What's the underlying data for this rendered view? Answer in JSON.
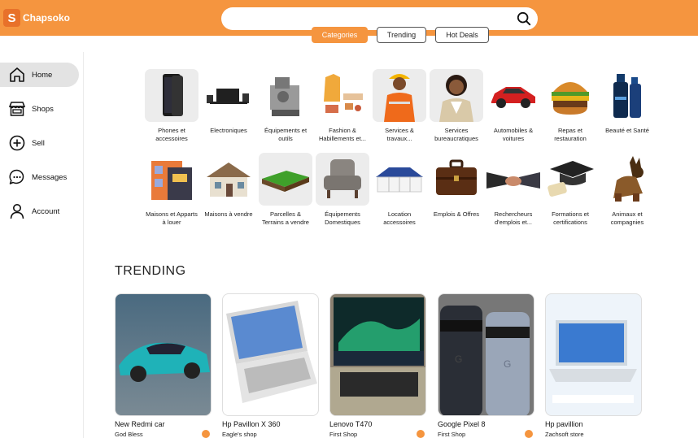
{
  "brand": {
    "name": "Chapsoko",
    "mark": "S",
    "accent": "#f5953f"
  },
  "search": {
    "placeholder": "",
    "icon": "search-icon"
  },
  "tabs": [
    {
      "label": "Categories",
      "active": true
    },
    {
      "label": "Trending",
      "active": false
    },
    {
      "label": "Hot Deals",
      "active": false
    }
  ],
  "sidebar": {
    "items": [
      {
        "label": "Home",
        "icon": "home-icon",
        "active": true
      },
      {
        "label": "Shops",
        "icon": "shop-icon",
        "active": false
      },
      {
        "label": "Sell",
        "icon": "plus-circle-icon",
        "active": false
      },
      {
        "label": "Messages",
        "icon": "chat-bubble-icon",
        "active": false
      },
      {
        "label": "Account",
        "icon": "user-icon",
        "active": false
      }
    ]
  },
  "categories": [
    {
      "label": "Phones et accessoires",
      "icon": "smartphone-icon"
    },
    {
      "label": "Electroniques",
      "icon": "tv-icon"
    },
    {
      "label": "Équipements et outils",
      "icon": "machine-icon"
    },
    {
      "label": "Fashion & Habillements et...",
      "icon": "clothes-icon"
    },
    {
      "label": "Services & travaux...",
      "icon": "worker-icon"
    },
    {
      "label": "Services bureaucratiques",
      "icon": "office-person-icon"
    },
    {
      "label": "Automobiles & voitures",
      "icon": "car-icon"
    },
    {
      "label": "Repas et restauration",
      "icon": "burger-icon"
    },
    {
      "label": "Beauté et Santé",
      "icon": "perfume-icon"
    },
    {
      "label": "Maisons et Apparts à louer",
      "icon": "apartment-icon"
    },
    {
      "label": "Maisons à vendre",
      "icon": "house-icon"
    },
    {
      "label": "Parcelles & Terrains a vendre",
      "icon": "land-icon"
    },
    {
      "label": "Équipements Domestiques",
      "icon": "armchair-icon"
    },
    {
      "label": "Location accessoires",
      "icon": "tent-icon"
    },
    {
      "label": "Emplois & Offres",
      "icon": "briefcase-icon"
    },
    {
      "label": "Rechercheurs d'emplois et...",
      "icon": "handshake-icon"
    },
    {
      "label": "Formations et certifications",
      "icon": "graduation-cap-icon"
    },
    {
      "label": "Animaux et compagnies",
      "icon": "dog-icon"
    }
  ],
  "trending": {
    "title": "TRENDING",
    "items": [
      {
        "title": "New Redmi car",
        "shop": "God Bless"
      },
      {
        "title": "Hp Pavillon X 360",
        "shop": "Eagle's shop"
      },
      {
        "title": "Lenovo T470",
        "shop": "First Shop"
      },
      {
        "title": "Google Pixel 8",
        "shop": "First Shop"
      },
      {
        "title": "Hp pavillion",
        "shop": "Zachsoft store"
      }
    ]
  }
}
